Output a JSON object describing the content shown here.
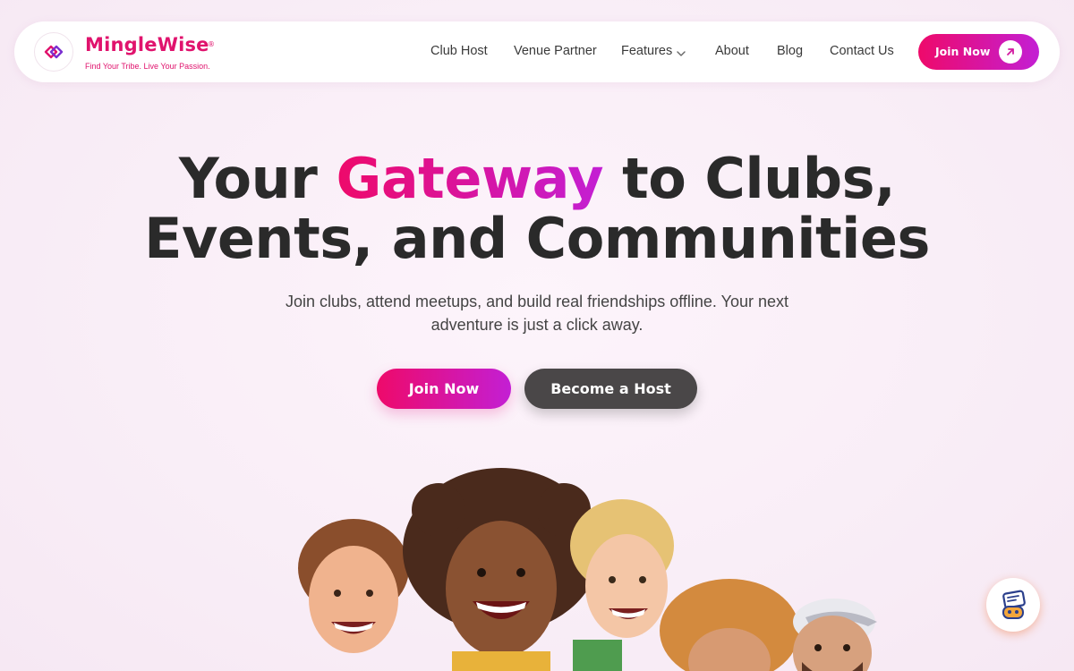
{
  "brand": {
    "name": "MingleWise",
    "registered": "®",
    "tagline": "Find Your Tribe. Live Your Passion."
  },
  "nav": {
    "links": [
      "Club Host",
      "Venue Partner",
      "Features",
      "About",
      "Blog",
      "Contact Us"
    ],
    "join_label": "Join Now"
  },
  "hero": {
    "title_part1": "Your ",
    "title_accent": "Gateway",
    "title_part2": " to Clubs,",
    "title_line2": "Events, and Communities",
    "subtitle": "Join clubs, attend meetups, and build real friendships offline. Your next adventure is just a click away.",
    "primary_cta": "Join Now",
    "secondary_cta": "Become a Host"
  },
  "icons": {
    "logo": "logo-mark-icon",
    "features_dropdown": "chevron-down-icon",
    "join_arrow": "arrow-up-right-icon",
    "chat": "chat-bot-icon"
  },
  "colors": {
    "brand_pink": "#e0136d",
    "gradient_start": "#ee0a6a",
    "gradient_end": "#c31fd4",
    "dark_button": "#4a4748",
    "heading": "#2a2a2a",
    "chat_accent": "#f07a3c"
  }
}
